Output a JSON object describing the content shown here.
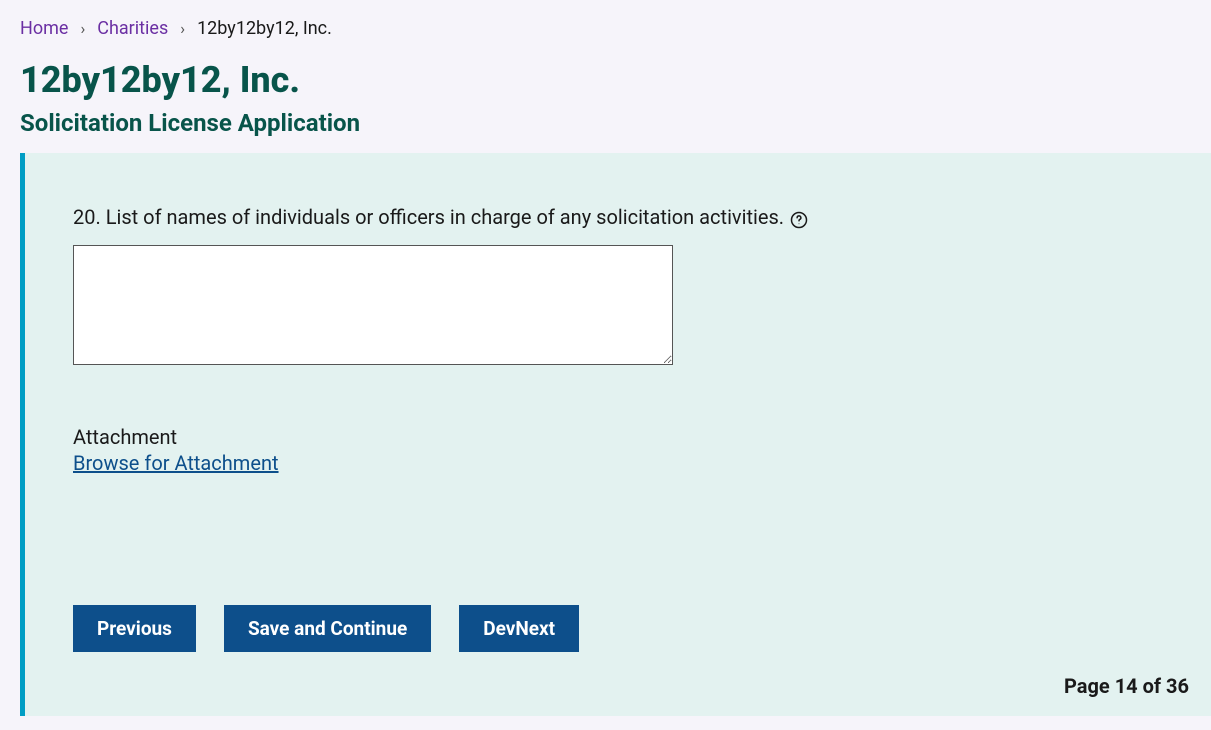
{
  "breadcrumb": {
    "home": "Home",
    "charities": "Charities",
    "current": "12by12by12, Inc."
  },
  "header": {
    "title": "12by12by12, Inc.",
    "subtitle": "Solicitation License Application"
  },
  "question": {
    "label": "20. List of names of individuals or officers in charge of any solicitation activities.",
    "value": ""
  },
  "attachment": {
    "label": "Attachment",
    "link": "Browse for Attachment"
  },
  "buttons": {
    "previous": "Previous",
    "save_continue": "Save and Continue",
    "devnext": "DevNext"
  },
  "pagination": {
    "text": "Page 14 of 36"
  }
}
